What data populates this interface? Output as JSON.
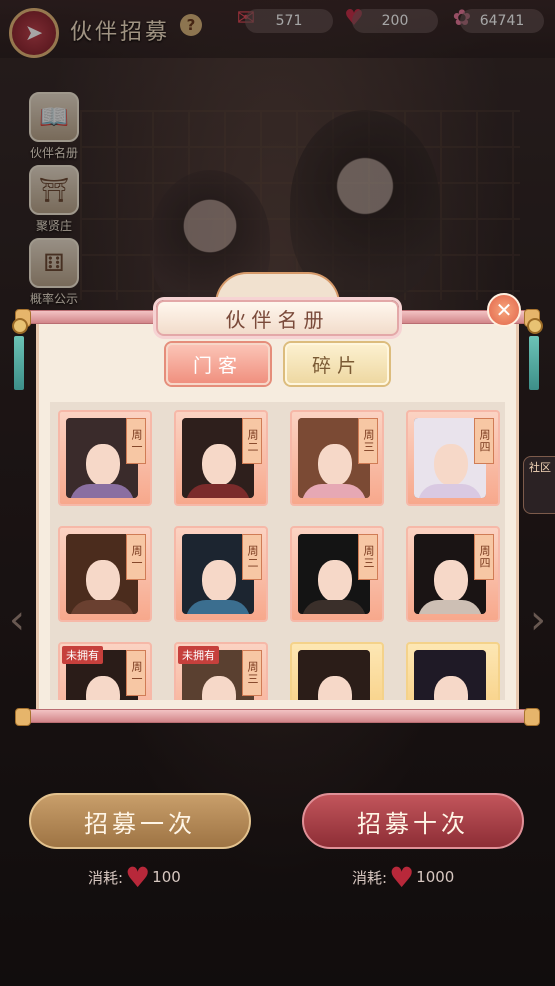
{
  "header": {
    "title": "伙伴招募",
    "help": "?"
  },
  "resources": [
    {
      "name": "ticket",
      "icon": "ticket-icon",
      "value": "571"
    },
    {
      "name": "heart",
      "icon": "heart-icon",
      "value": "200"
    },
    {
      "name": "gem",
      "icon": "gem-icon",
      "value": "64741"
    }
  ],
  "side_menu": [
    {
      "label": "伙伴名册",
      "icon": "book-icon"
    },
    {
      "label": "聚贤庄",
      "icon": "pavilion-icon"
    },
    {
      "label": "概率公示",
      "icon": "dice-icon"
    }
  ],
  "community": {
    "label": "社区"
  },
  "modal": {
    "title": "伙伴名册",
    "tabs": [
      {
        "label": "门客",
        "active": true
      },
      {
        "label": "碎片",
        "active": false
      }
    ],
    "partners": [
      {
        "day": "周一",
        "unowned": "",
        "hair": "#3a2b2b",
        "body": "#8a6fa1",
        "frame": "pink"
      },
      {
        "day": "周二",
        "unowned": "",
        "hair": "#2e1f1c",
        "body": "#7b2b2b",
        "frame": "pink"
      },
      {
        "day": "周三",
        "unowned": "",
        "hair": "#7b4a34",
        "body": "#e6a8b4",
        "frame": "pink"
      },
      {
        "day": "周四",
        "unowned": "",
        "hair": "#e9e3ec",
        "body": "#d9c9e2",
        "frame": "pink"
      },
      {
        "day": "周一",
        "unowned": "",
        "hair": "#4b2c1d",
        "body": "#6a4030",
        "frame": "pink"
      },
      {
        "day": "周二",
        "unowned": "",
        "hair": "#1c2530",
        "body": "#3b6e8f",
        "frame": "pink"
      },
      {
        "day": "周三",
        "unowned": "",
        "hair": "#141414",
        "body": "#3a2f2a",
        "frame": "pink"
      },
      {
        "day": "周四",
        "unowned": "",
        "hair": "#1a1414",
        "body": "#cdbfb4",
        "frame": "pink"
      },
      {
        "day": "周一",
        "unowned": "未拥有",
        "hair": "#2a1c18",
        "body": "#b98a4a",
        "frame": "pink"
      },
      {
        "day": "周三",
        "unowned": "未拥有",
        "hair": "#5a4030",
        "body": "#c28c7a",
        "frame": "pink"
      },
      {
        "day": "",
        "unowned": "",
        "hair": "#2b1d18",
        "body": "#c03a3a",
        "frame": "gold"
      },
      {
        "day": "",
        "unowned": "",
        "hair": "#1f1a26",
        "body": "#8fb0d8",
        "frame": "gold"
      }
    ]
  },
  "recruit": {
    "once_label": "招募一次",
    "ten_label": "招募十次",
    "cost_label": "消耗:",
    "once_cost": "100",
    "ten_cost": "1000"
  }
}
